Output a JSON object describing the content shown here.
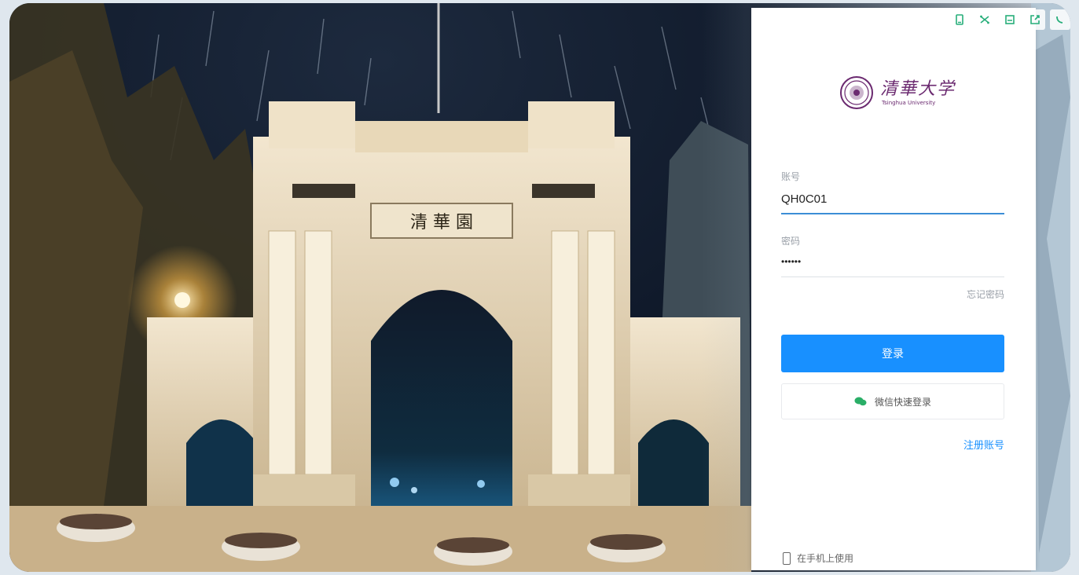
{
  "topbar": {
    "icons": [
      "mobile-view-icon",
      "shuffle-icon",
      "save-icon",
      "share-icon",
      "phone-call-icon"
    ],
    "color": "#27ae7a"
  },
  "logo": {
    "name_cn": "清華大学",
    "name_en": "Tsinghua University",
    "color": "#6b2a70"
  },
  "gate_inscription": "清 華 園",
  "form": {
    "account_label": "账号",
    "account_value": "QH0C01",
    "password_label": "密码",
    "password_value": "••••••",
    "forgot_label": "忘记密码",
    "login_label": "登录",
    "wechat_label": "微信快速登录",
    "register_label": "注册账号",
    "mobile_label": "在手机上使用"
  },
  "colors": {
    "primary": "#1890ff",
    "wechat": "#2aae67"
  }
}
